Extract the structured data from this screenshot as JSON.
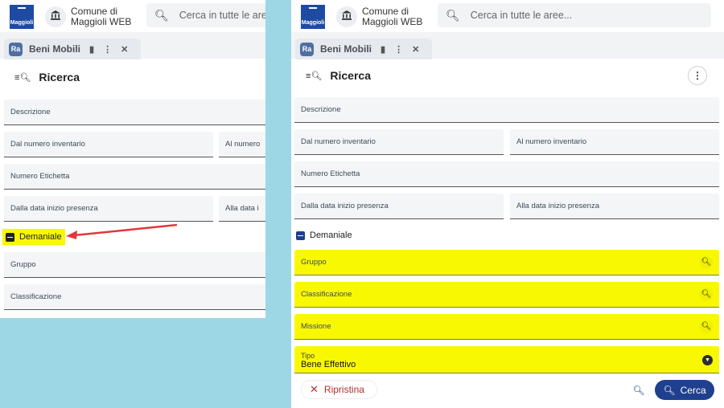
{
  "header": {
    "logo_text": "Maggioli",
    "comune_line1": "Comune di",
    "comune_line2": "Maggioli WEB",
    "search_placeholder": "Cerca in tutte le aree..."
  },
  "tab": {
    "badge": "Ra",
    "label": "Beni Mobili",
    "bookmark_icon": "bookmark-icon",
    "more_icon": "more-vert-icon",
    "close_icon": "close-icon"
  },
  "section": {
    "title": "Ricerca"
  },
  "fields": {
    "descrizione": "Descrizione",
    "dal_numero_inventario": "Dal numero inventario",
    "al_numero_inventario": "Al numero inventario",
    "numero_etichetta": "Numero Etichetta",
    "dalla_data": "Dalla data inizio presenza",
    "alla_data": "Alla data inizio presenza",
    "gruppo": "Gruppo",
    "classificazione": "Classificazione",
    "missione": "Missione",
    "tipo_label": "Tipo",
    "tipo_value": "Bene Effettivo"
  },
  "left_panel": {
    "al_numero_truncated": "Al numero",
    "alla_data_truncated": "Alla data i"
  },
  "toggle": {
    "label": "Demaniale"
  },
  "actions": {
    "reset_label": "Ripristina",
    "search_label": "Cerca"
  },
  "colors": {
    "highlight": "#f8f802",
    "primary": "#1f3f8f",
    "arrow": "#e0383a",
    "background": "#9dd7e6"
  }
}
